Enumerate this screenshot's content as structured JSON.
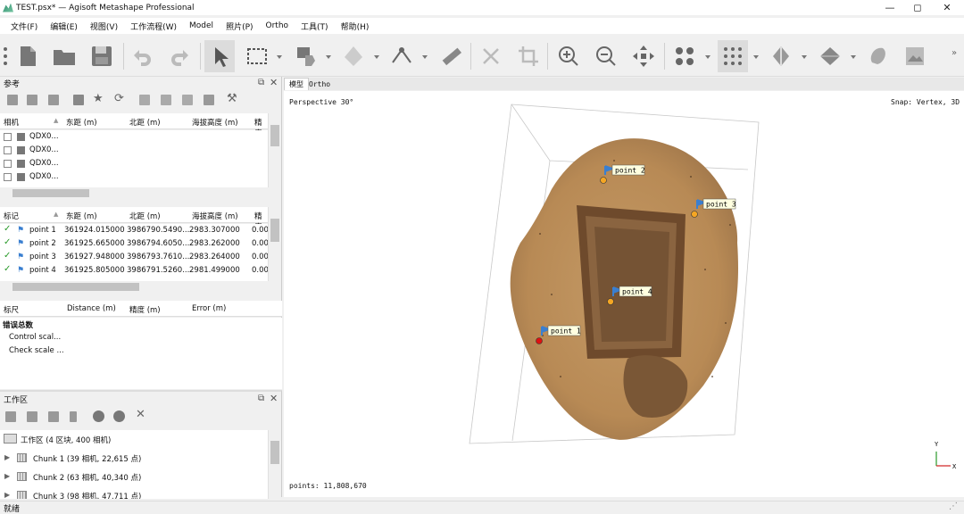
{
  "window": {
    "title": "TEST.psx* — Agisoft Metashape Professional",
    "min": "—",
    "max": "◻",
    "close": "✕"
  },
  "menu": [
    "文件(F)",
    "编辑(E)",
    "视图(V)",
    "工作流程(W)",
    "Model",
    "照片(P)",
    "Ortho",
    "工具(T)",
    "帮助(H)"
  ],
  "toolbar": {
    "buttons": [
      "drag-handle-icon",
      "new-icon",
      "open-folder-icon",
      "save-icon",
      "undo-icon",
      "redo-icon",
      "select-pointer-icon",
      "rectangle-selection-icon",
      "hand-select-icon",
      "shape-icon",
      "measure-icon",
      "ruler-icon",
      "delete-icon",
      "crop-icon",
      "zoom-in-icon",
      "zoom-out-icon",
      "move-icon",
      "points-icon",
      "dense-points-icon",
      "tiled-model-icon",
      "model-icon",
      "texture-icon",
      "orthophoto-icon"
    ],
    "overflow": "»"
  },
  "reference": {
    "title": "参考",
    "cameras": {
      "headers": [
        "相机",
        "东距 (m)",
        "北距 (m)",
        "海拔高度 (m)",
        "精度"
      ],
      "rows": [
        "QDX0...",
        "QDX0...",
        "QDX0...",
        "QDX0..."
      ]
    },
    "markers": {
      "headers": [
        "标记",
        "东距 (m)",
        "北距 (m)",
        "海拔高度 (m)",
        "精度"
      ],
      "rows": [
        {
          "name": "point 1",
          "east": "361924.015000",
          "north": "3986790.5490...",
          "alt": "2983.307000",
          "acc": "0.00"
        },
        {
          "name": "point 2",
          "east": "361925.665000",
          "north": "3986794.6050...",
          "alt": "2983.262000",
          "acc": "0.00"
        },
        {
          "name": "point 3",
          "east": "361927.948000",
          "north": "3986793.7610...",
          "alt": "2983.264000",
          "acc": "0.00"
        },
        {
          "name": "point 4",
          "east": "361925.805000",
          "north": "3986791.5260...",
          "alt": "2981.499000",
          "acc": "0.00"
        }
      ]
    },
    "scalebars": {
      "headers": [
        "标尺",
        "Distance (m)",
        "精度 (m)",
        "Error (m)"
      ],
      "total_label": "错误总数",
      "rows": [
        "Control scal...",
        "Check scale ..."
      ]
    }
  },
  "workspace": {
    "title": "工作区",
    "root": "工作区 (4 区块, 400 相机)",
    "chunks": [
      "Chunk 1 (39 相机, 22,615 点)",
      "Chunk 2 (63 相机, 40,340 点)",
      "Chunk 3 (98 相机, 47,711 点)"
    ]
  },
  "viewport": {
    "tabs": [
      "模型",
      "Ortho"
    ],
    "perspective": "Perspective 30°",
    "snap": "Snap: Vertex, 3D",
    "points": "points: 11,808,670",
    "markers": [
      "point 2",
      "point 3",
      "point 4",
      "point 1"
    ],
    "axes": {
      "y": "Y",
      "x": "X"
    }
  },
  "status": {
    "text": "就绪"
  },
  "colors": {
    "accent": "#3a7fd0",
    "marker_label_bg": "#ffffe0",
    "marker_dot": "#f5a623",
    "selected_dot": "#e01010"
  }
}
